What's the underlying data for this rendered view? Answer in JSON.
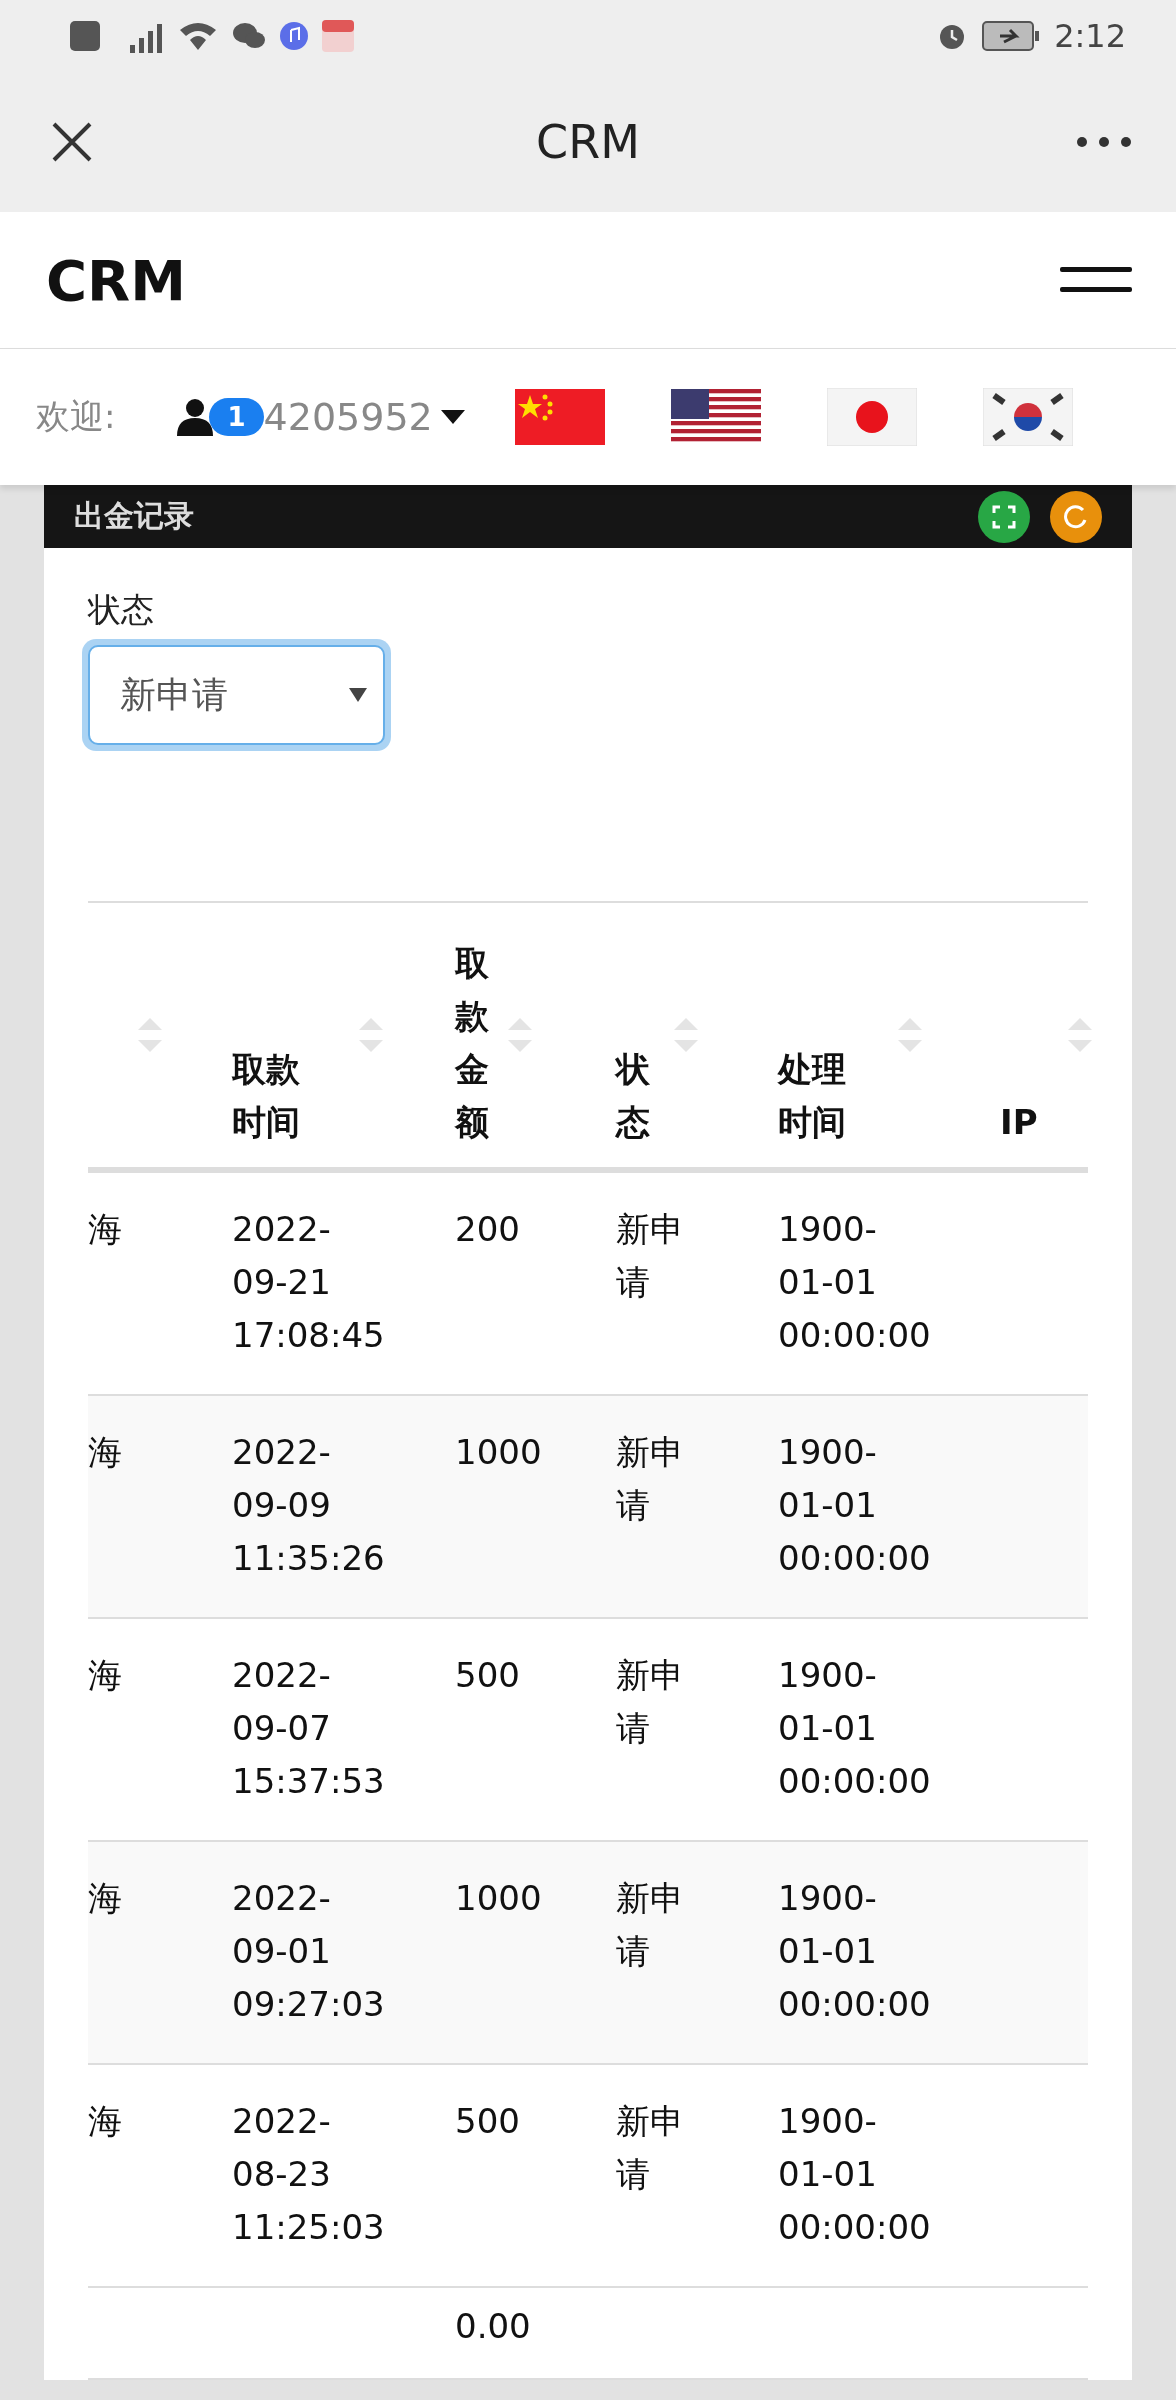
{
  "status_bar": {
    "time": "2:12"
  },
  "app_bar": {
    "title": "CRM"
  },
  "site_nav": {
    "brand": "CRM"
  },
  "welcome": {
    "label": "欢迎:",
    "badge": "1",
    "user": "4205952",
    "flags": [
      {
        "kind": "china"
      },
      {
        "kind": "usa"
      },
      {
        "kind": "japan"
      },
      {
        "kind": "korea"
      }
    ]
  },
  "panel": {
    "title": "出金记录",
    "filter": {
      "label": "状态",
      "value": "新申请",
      "focused": true
    }
  },
  "table": {
    "columns": [
      {
        "sortable": true
      },
      {
        "label": "取款时间",
        "sortable": true
      },
      {
        "label": "取款金额",
        "sortable": true
      },
      {
        "label": "状态",
        "sortable": true
      },
      {
        "label": "处理时间",
        "sortable": true
      },
      {
        "label": "IP",
        "sortable": true
      }
    ],
    "rows": [
      {
        "column_1": "海",
        "time": "2022-09-21 17:08:45",
        "amount": "200",
        "status": "新申请",
        "processed": "1900-01-01 00:00:00"
      },
      {
        "column_1": "海",
        "time": "2022-09-09 11:35:26",
        "amount": "1000",
        "status": "新申请",
        "processed": "1900-01-01 00:00:00"
      },
      {
        "column_1": "海",
        "time": "2022-09-07 15:37:53",
        "amount": "500",
        "status": "新申请",
        "processed": "1900-01-01 00:00:00"
      },
      {
        "column_1": "海",
        "time": "2022-09-01 09:27:03",
        "amount": "1000",
        "status": "新申请",
        "processed": "1900-01-01 00:00:00"
      },
      {
        "column_1": "海",
        "time": "2022-08-23 11:25:03",
        "amount": "500",
        "status": "新申请",
        "processed": "1900-01-01 00:00:00"
      }
    ],
    "total": {
      "amount": "0.00"
    }
  }
}
